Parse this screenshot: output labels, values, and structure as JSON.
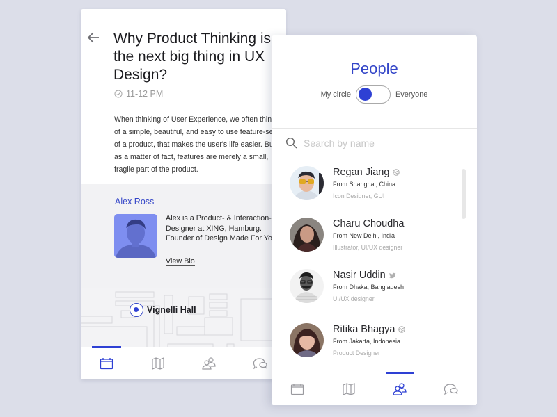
{
  "article_screen": {
    "title": "Why Product Thinking is the next big thing in UX Design?",
    "time": "11-12 PM",
    "body": "When thinking of User Experience, we often think of a simple, beautiful, and easy to use feature-set of a product, that makes the user's life easier. But as a matter of fact, features are merely a small, fragile part of the product.",
    "author": {
      "name": "Alex Ross",
      "bio": "Alex is a Product- & Interaction- Designer at XING, Hamburg. Founder of Design Made For You",
      "view_bio_label": "View Bio"
    },
    "location": "Vignelli Hall",
    "nav": [
      {
        "icon": "calendar-icon",
        "active": true
      },
      {
        "icon": "map-icon",
        "active": false
      },
      {
        "icon": "people-icon",
        "active": false
      },
      {
        "icon": "chat-icon",
        "active": false
      }
    ]
  },
  "people_screen": {
    "title": "People",
    "toggle_left": "My circle",
    "toggle_right": "Everyone",
    "search_placeholder": "Search by name",
    "people": [
      {
        "name": "Regan Jiang",
        "social": "dribbble-icon",
        "from": "From Shanghai, China",
        "role": "Icon Designer, GUI"
      },
      {
        "name": "Charu Choudha",
        "social": "",
        "from": "From New Delhi, India",
        "role": "Illustrator, UI/UX designer"
      },
      {
        "name": "Nasir Uddin",
        "social": "twitter-icon",
        "from": "From Dhaka, Bangladesh",
        "role": "UI/UX designer"
      },
      {
        "name": "Ritika Bhagya",
        "social": "dribbble-icon",
        "from": "From Jakarta, Indonesia",
        "role": "Product Designer"
      }
    ],
    "nav": [
      {
        "icon": "calendar-icon",
        "active": false
      },
      {
        "icon": "map-icon",
        "active": false
      },
      {
        "icon": "people-icon",
        "active": true
      },
      {
        "icon": "chat-icon",
        "active": false
      }
    ]
  },
  "colors": {
    "accent": "#2e40d4",
    "background": "#dcdee9",
    "author_photo_tint": "#7e8ef0"
  }
}
